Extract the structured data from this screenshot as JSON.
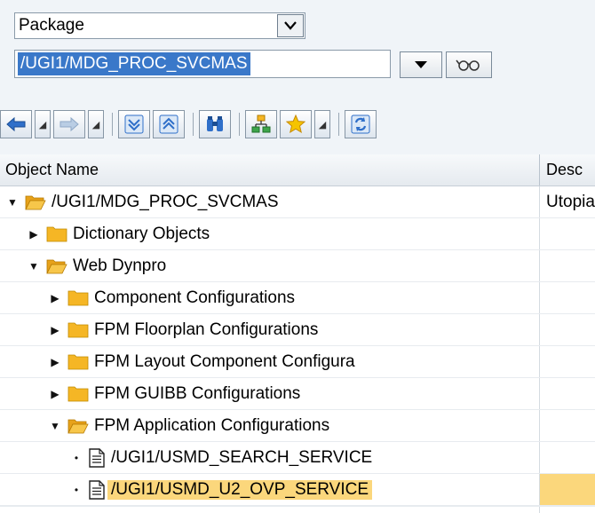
{
  "selector": {
    "object_type": "Package",
    "object_value": "/UGI1/MDG_PROC_SVCMAS"
  },
  "toolbar": {
    "icons": [
      "back-icon",
      "back-menu",
      "forward-icon",
      "forward-menu",
      "collapse-all-icon",
      "expand-all-icon",
      "find-icon",
      "hierarchy-icon",
      "favorites-icon",
      "favorites-menu",
      "refresh-icon"
    ]
  },
  "tree": {
    "columns": {
      "object_name": "Object Name",
      "description": "Desc"
    },
    "rows": [
      {
        "label": "/UGI1/MDG_PROC_SVCMAS",
        "desc": "Utopia",
        "level": 0,
        "node": "open-folder"
      },
      {
        "label": "Dictionary Objects",
        "desc": "",
        "level": 1,
        "node": "closed-folder"
      },
      {
        "label": "Web Dynpro",
        "desc": "",
        "level": 1,
        "node": "open-folder"
      },
      {
        "label": "Component Configurations",
        "desc": "",
        "level": 2,
        "node": "closed-folder"
      },
      {
        "label": "FPM Floorplan Configurations",
        "desc": "",
        "level": 2,
        "node": "closed-folder"
      },
      {
        "label": "FPM Layout Component Configura",
        "desc": "",
        "level": 2,
        "node": "closed-folder"
      },
      {
        "label": "FPM GUIBB Configurations",
        "desc": "",
        "level": 2,
        "node": "closed-folder"
      },
      {
        "label": "FPM Application Configurations",
        "desc": "",
        "level": 2,
        "node": "open-folder"
      },
      {
        "label": "/UGI1/USMD_SEARCH_SERVICE",
        "desc": "",
        "level": 3,
        "node": "document"
      },
      {
        "label": "/UGI1/USMD_U2_OVP_SERVICE",
        "desc": "",
        "level": 3,
        "node": "document",
        "selected": true
      }
    ]
  },
  "colors": {
    "selection": "#fbd77c",
    "input_selection": "#3a78c9",
    "folder": "#f5b625"
  }
}
